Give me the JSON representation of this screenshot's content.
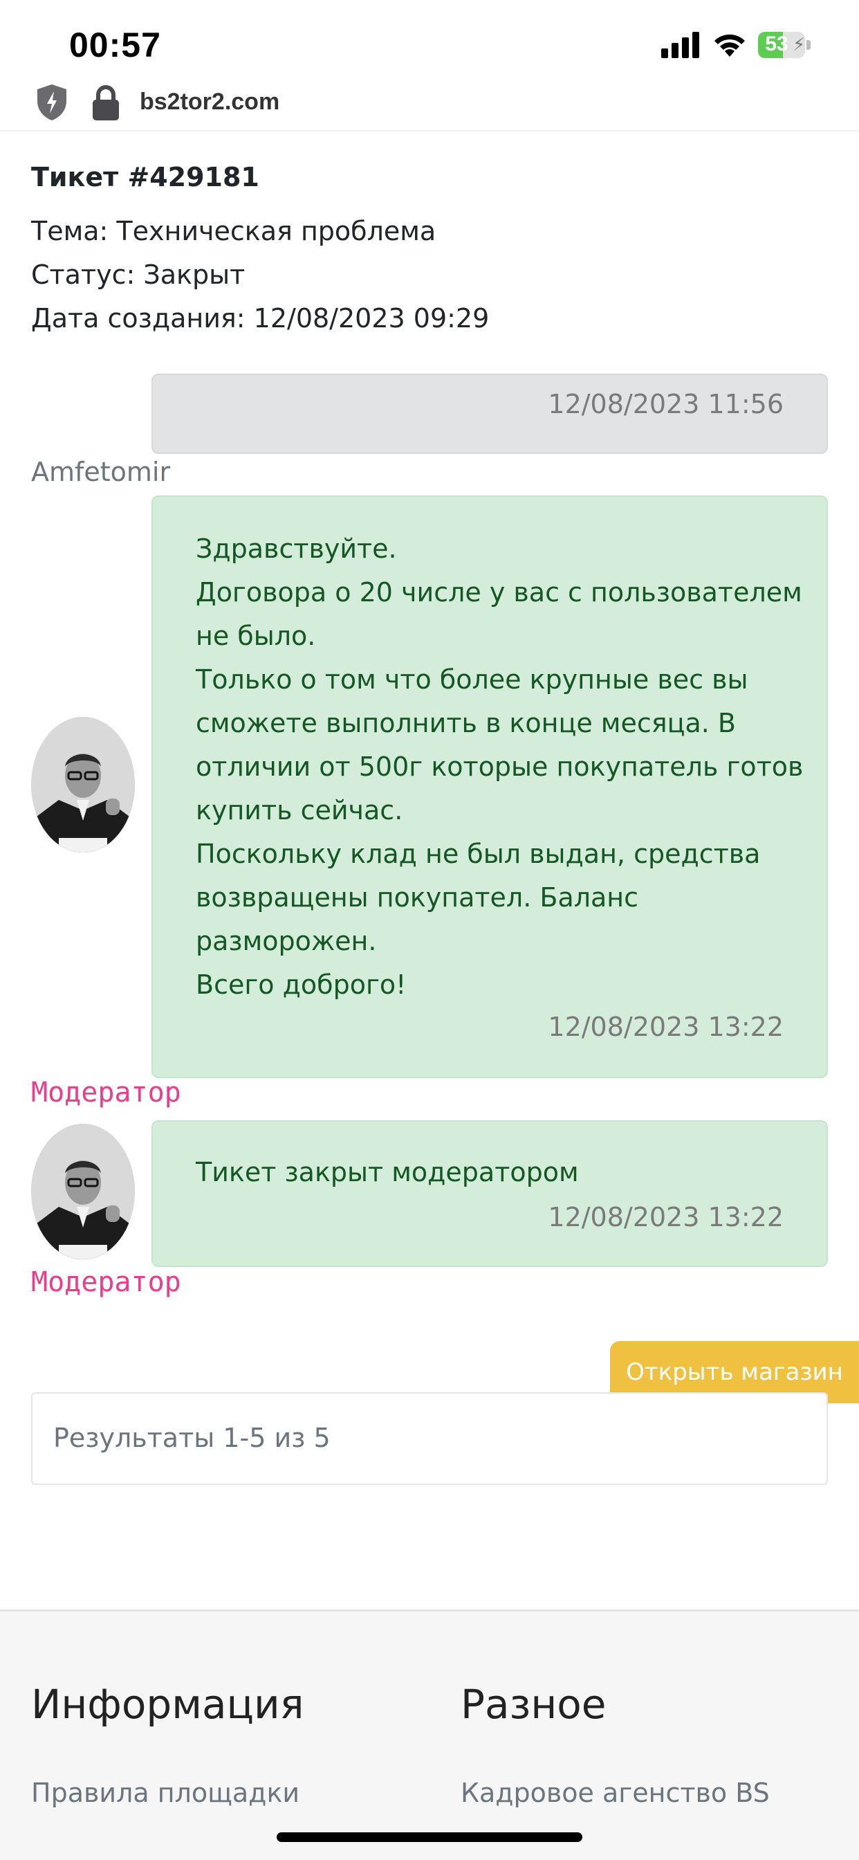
{
  "status_bar": {
    "time": "00:57",
    "battery": "53",
    "battery_level": 0.53
  },
  "url_bar": {
    "url": "bs2tor2.com"
  },
  "ticket": {
    "title": "Тикет #429181",
    "topic": "Тема: Техническая проблема",
    "status": "Статус: Закрыт",
    "created": "Дата создания: 12/08/2023 09:29"
  },
  "messages": [
    {
      "time": "12/08/2023 11:56",
      "author": "Amfetomir"
    },
    {
      "text": "Здравствуйте.\nДоговора о 20 числе у вас с пользователем\nне было.\nТолько о том что более крупные вес вы\nсможете выполнить в конце месяца. В\nотличии от 500г которые покупатель готов\nкупить сейчас.\nПоскольку клад не был выдан, средства\nвозвращены покупател. Баланс\nразморожен.\nВсего доброго!",
      "time": "12/08/2023 13:22",
      "author": "Модератор"
    },
    {
      "text": "Тикет закрыт модератором",
      "time": "12/08/2023 13:22",
      "author": "Модератор"
    }
  ],
  "shop_button": "Открыть магазин",
  "results": "Результаты 1-5 из 5",
  "footer": {
    "col1_title": "Информация",
    "col1_link": "Правила площадки",
    "col2_title": "Разное",
    "col2_link": "Кадровое агенство BS"
  }
}
